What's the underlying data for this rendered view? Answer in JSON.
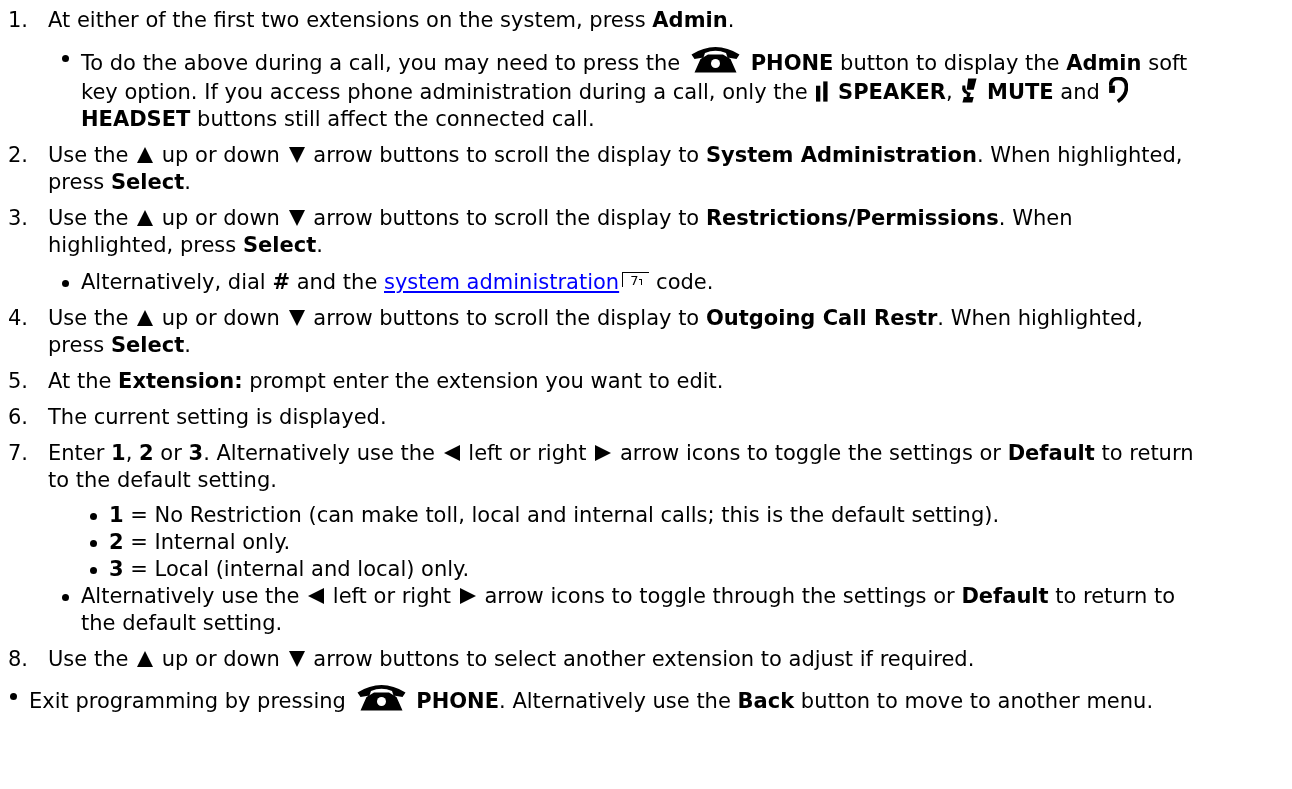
{
  "steps": [
    {
      "number": "1.",
      "parts": [
        {
          "kind": "text",
          "text": "At either of the first two extensions on the system, press **Admin**."
        }
      ],
      "notes": [
        {
          "parts": [
            {
              "kind": "text",
              "text": "To do the above during a call, you may need to press the"
            },
            {
              "kind": "phone"
            },
            {
              "kind": "text",
              "text": "**PHONE** button to display the **Admin** soft"
            },
            {
              "kind": "text",
              "text": "key option. If you access phone administration during a call, only the",
              "break": true
            },
            {
              "kind": "speaker"
            },
            {
              "kind": "text",
              "text": "**SPEAKER**,"
            },
            {
              "kind": "mute"
            },
            {
              "kind": "text",
              "text": "**MUTE** and"
            },
            {
              "kind": "headset"
            },
            {
              "kind": "text",
              "text": "**HEADSET** buttons still affect the connected call.",
              "break": true
            }
          ]
        }
      ]
    },
    {
      "number": "2.",
      "parts": [
        {
          "kind": "text",
          "text": "Use the"
        },
        {
          "kind": "up"
        },
        {
          "kind": "text",
          "text": "up or down"
        },
        {
          "kind": "down"
        },
        {
          "kind": "text",
          "text": "arrow buttons to scroll the display to **System Administration**. When highlighted,"
        },
        {
          "kind": "text",
          "text": "press **Select**.",
          "break": true
        }
      ]
    },
    {
      "number": "3.",
      "parts": [
        {
          "kind": "text",
          "text": "Use the"
        },
        {
          "kind": "up"
        },
        {
          "kind": "text",
          "text": "up or down"
        },
        {
          "kind": "down"
        },
        {
          "kind": "text",
          "text": "arrow buttons to scroll the display to **Restrictions/Permissions**. When"
        },
        {
          "kind": "text",
          "text": "highlighted, press **Select**.",
          "break": true
        }
      ],
      "notes": [
        {
          "parts": [
            {
              "kind": "text",
              "text": "Alternatively, dial **#** and the"
            },
            {
              "kind": "link",
              "text": "system administration",
              "ref": "7"
            },
            {
              "kind": "text",
              "text": "code."
            }
          ]
        }
      ]
    },
    {
      "number": "4.",
      "parts": [
        {
          "kind": "text",
          "text": "Use the"
        },
        {
          "kind": "up"
        },
        {
          "kind": "text",
          "text": "up or down"
        },
        {
          "kind": "down"
        },
        {
          "kind": "text",
          "text": "arrow buttons to scroll the display to **Outgoing Call Restr**. When highlighted,"
        },
        {
          "kind": "text",
          "text": "press **Select**.",
          "break": true
        }
      ]
    },
    {
      "number": "5.",
      "parts": [
        {
          "kind": "text",
          "text": "At the **Extension:** prompt enter the extension you want to edit."
        }
      ]
    },
    {
      "number": "6.",
      "parts": [
        {
          "kind": "text",
          "text": "The current setting is displayed."
        }
      ]
    },
    {
      "number": "7.",
      "parts": [
        {
          "kind": "text",
          "text": "Enter **1**, **2** or **3**. Alternatively use the"
        },
        {
          "kind": "left"
        },
        {
          "kind": "text",
          "text": "left or right"
        },
        {
          "kind": "right"
        },
        {
          "kind": "text",
          "text": "arrow icons to toggle the settings or **Default** to return"
        },
        {
          "kind": "text",
          "text": "to the default setting.",
          "break": true
        }
      ],
      "options": [
        {
          "parts": [
            {
              "kind": "text",
              "text": "**1** = No Restriction (can make toll, local and internal calls; this is the default setting)."
            }
          ]
        },
        {
          "parts": [
            {
              "kind": "text",
              "text": "**2** = Internal only."
            }
          ]
        },
        {
          "parts": [
            {
              "kind": "text",
              "text": "**3** = Local (internal and local) only."
            }
          ]
        }
      ],
      "notes": [
        {
          "parts": [
            {
              "kind": "text",
              "text": "Alternatively use the"
            },
            {
              "kind": "left"
            },
            {
              "kind": "text",
              "text": "left or right"
            },
            {
              "kind": "right"
            },
            {
              "kind": "text",
              "text": "arrow icons to toggle through the settings or **Default** to return to"
            },
            {
              "kind": "text",
              "text": "the default setting.",
              "break": true
            }
          ]
        }
      ]
    },
    {
      "number": "8.",
      "parts": [
        {
          "kind": "text",
          "text": "Use the"
        },
        {
          "kind": "up"
        },
        {
          "kind": "text",
          "text": "up or down"
        },
        {
          "kind": "down"
        },
        {
          "kind": "text",
          "text": "arrow buttons to select another extension to adjust if required."
        }
      ]
    }
  ],
  "footer": [
    {
      "parts": [
        {
          "kind": "text",
          "text": "Exit programming by pressing"
        },
        {
          "kind": "phone"
        },
        {
          "kind": "text",
          "text": "**PHONE**. Alternatively use the **Back** button to move to another menu."
        }
      ]
    }
  ]
}
